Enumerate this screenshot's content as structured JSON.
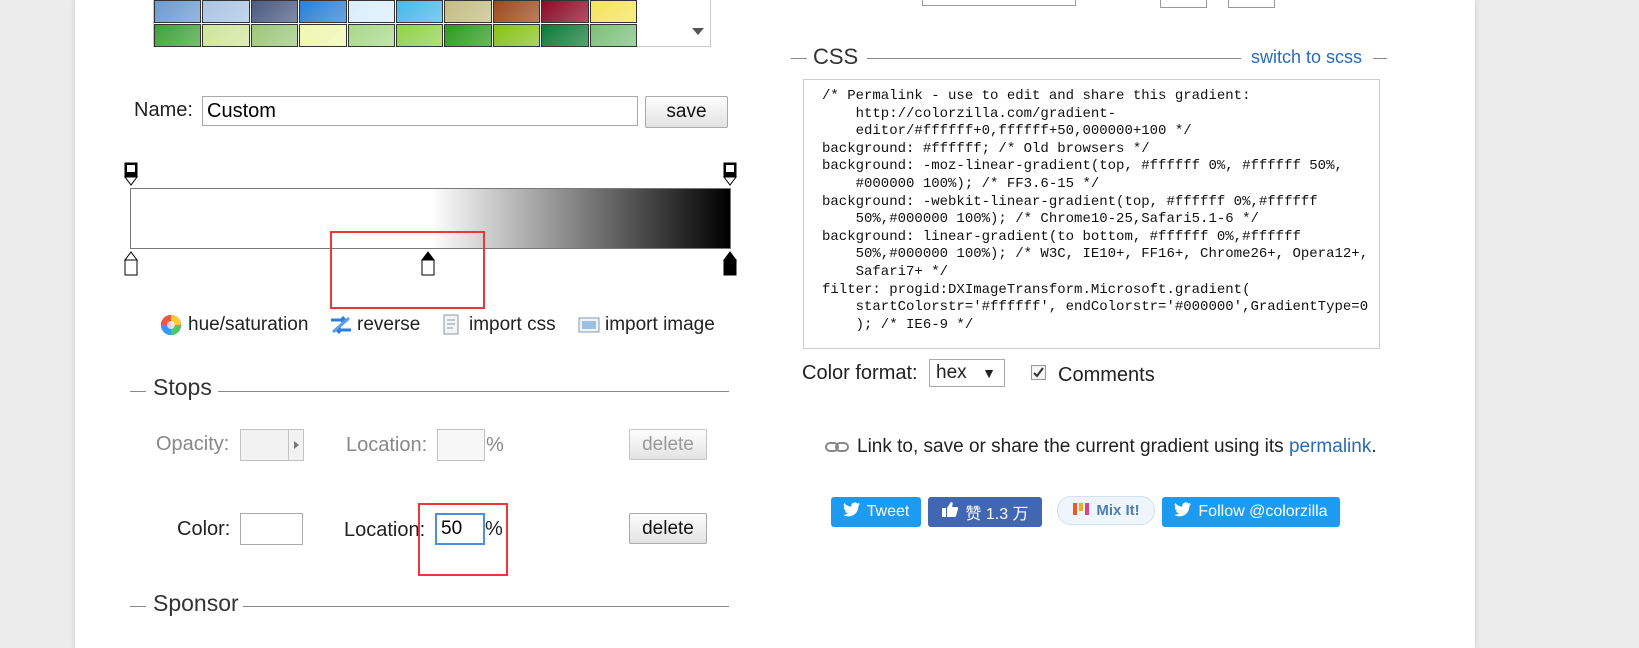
{
  "presets": {
    "row1": [
      "#6b9ad0",
      "#a9c4e4",
      "#4b5a80",
      "#2a7fd6",
      "#d9eefb",
      "#48b8e8",
      "#c3bd83",
      "#9b4a1e",
      "#8c0a26",
      "#f4e45b"
    ],
    "row2": [
      "#3fa23a",
      "#cfe59b",
      "#9cc77b",
      "#eef7b0",
      "#a8d98a",
      "#8fd24a",
      "#2c9a1f",
      "#86c21a",
      "#0f7a36",
      "#7cc07a"
    ]
  },
  "name": {
    "label": "Name:",
    "value": "Custom",
    "save_label": "save"
  },
  "gradient": {
    "css": "linear-gradient(to right, #ffffff 0%, #ffffff 50%, #000000 100%)"
  },
  "toolbar": {
    "hue_saturation": "hue/saturation",
    "reverse": "reverse",
    "import_css": "import css",
    "import_image": "import image"
  },
  "stops": {
    "title": "Stops",
    "opacity_label": "Opacity:",
    "location_label": "Location:",
    "percent": "%",
    "delete_label": "delete",
    "color_label": "Color:",
    "color_value": "#ffffff",
    "location_value": "50"
  },
  "sponsor": {
    "title": "Sponsor"
  },
  "css_panel": {
    "title": "CSS",
    "switch_label": "switch to scss",
    "code": "/* Permalink - use to edit and share this gradient:\n    http://colorzilla.com/gradient-\n    editor/#ffffff+0,ffffff+50,000000+100 */\nbackground: #ffffff; /* Old browsers */\nbackground: -moz-linear-gradient(top, #ffffff 0%, #ffffff 50%,\n    #000000 100%); /* FF3.6-15 */\nbackground: -webkit-linear-gradient(top, #ffffff 0%,#ffffff\n    50%,#000000 100%); /* Chrome10-25,Safari5.1-6 */\nbackground: linear-gradient(to bottom, #ffffff 0%,#ffffff\n    50%,#000000 100%); /* W3C, IE10+, FF16+, Chrome26+, Opera12+,\n    Safari7+ */\nfilter: progid:DXImageTransform.Microsoft.gradient(\n    startColorstr='#ffffff', endColorstr='#000000',GradientType=0\n    ); /* IE6-9 */",
    "color_format_label": "Color format:",
    "color_format_value": "hex",
    "comments_label": "Comments"
  },
  "permalink": {
    "text": "Link to, save or share the current gradient using its",
    "link": "permalink",
    "end": "."
  },
  "social": {
    "tweet": "Tweet",
    "like": "赞 1.3 万",
    "mix": "Mix It!",
    "follow": "Follow @colorzilla"
  },
  "colors": {
    "highlight": "#e8383b",
    "link": "#2a6bb8",
    "twitter": "#1d9bf0",
    "facebook": "#4267b2"
  }
}
